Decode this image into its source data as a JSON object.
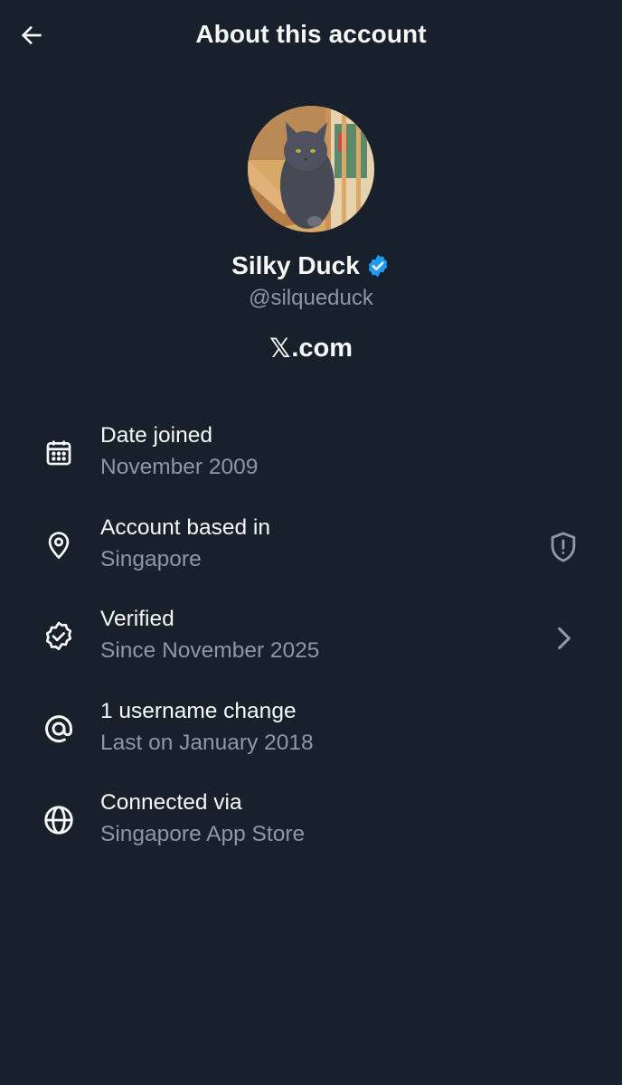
{
  "header": {
    "title": "About this account",
    "back_icon": "arrow-left-icon"
  },
  "profile": {
    "display_name": "Silky Duck",
    "handle": "@silqueduck",
    "verified_badge_color": "#1d9bf0",
    "source_logo": "𝕏",
    "source_suffix": ".com"
  },
  "info": [
    {
      "icon": "calendar-icon",
      "label": "Date joined",
      "value": "November 2009"
    },
    {
      "icon": "location-pin-icon",
      "label": "Account based in",
      "value": "Singapore",
      "trailing_icon": "shield-alert-icon"
    },
    {
      "icon": "verified-check-icon",
      "label": "Verified",
      "value": "Since November 2025",
      "trailing_icon": "chevron-right-icon"
    },
    {
      "icon": "at-sign-icon",
      "label": "1 username change",
      "value": "Last on January 2018"
    },
    {
      "icon": "globe-icon",
      "label": "Connected via",
      "value": "Singapore App Store"
    }
  ],
  "colors": {
    "background": "#17202b",
    "primary_text": "#f7f9f9",
    "secondary_text": "#8b98a5",
    "accent": "#1d9bf0"
  }
}
